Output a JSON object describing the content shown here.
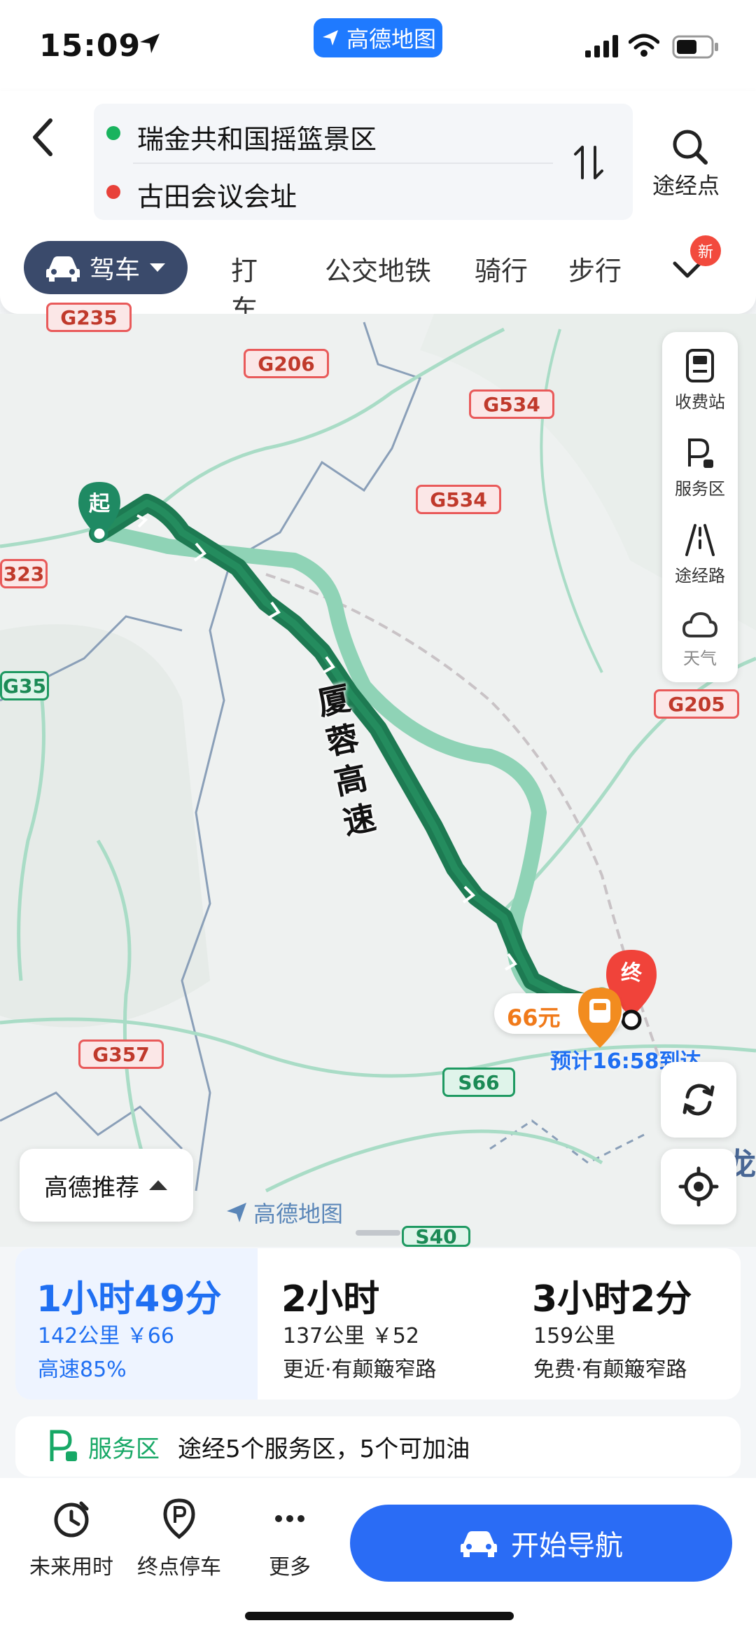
{
  "status": {
    "time": "15:09",
    "app_label": "高德地图"
  },
  "header": {
    "origin": "瑞金共和国摇篮景区",
    "destination": "古田会议会址",
    "waypoint_label": "途经点",
    "mode_selected": "驾车",
    "modes": [
      "打车",
      "公交地铁",
      "骑行",
      "步行"
    ],
    "new_badge": "新"
  },
  "map": {
    "highway_label": "厦蓉高速",
    "start_label": "起",
    "end_label": "终",
    "toll": "66元",
    "eta": "预计16:58到达",
    "shields": {
      "g206": "G206",
      "g534a": "G534",
      "g534b": "G534",
      "g205": "G205",
      "g357": "G357",
      "s66": "S66",
      "s40": "S40",
      "g323": "323",
      "g35": "G35",
      "g235": "G235"
    },
    "side_tools": [
      "收费站",
      "服务区",
      "途经路",
      "天气"
    ],
    "recommend": "高德推荐",
    "watermark": "高德地图",
    "edge_text": "龙"
  },
  "routes": [
    {
      "duration": "1小时49分",
      "distance": "142公里 ￥66",
      "note": "高速85%",
      "selected": true
    },
    {
      "duration": "2小时",
      "distance": "137公里 ￥52",
      "note": "更近·有颠簸窄路",
      "selected": false
    },
    {
      "duration": "3小时2分",
      "distance": "159公里",
      "note": "免费·有颠簸窄路",
      "selected": false
    }
  ],
  "service": {
    "label": "服务区",
    "text": "途经5个服务区，5个可加油"
  },
  "bottom": {
    "items": [
      "未来用时",
      "终点停车",
      "更多"
    ],
    "nav_button": "开始导航"
  },
  "colors": {
    "accent": "#2a6cf5",
    "route_main": "#1d7a52",
    "route_alt": "#8fd3b6"
  }
}
